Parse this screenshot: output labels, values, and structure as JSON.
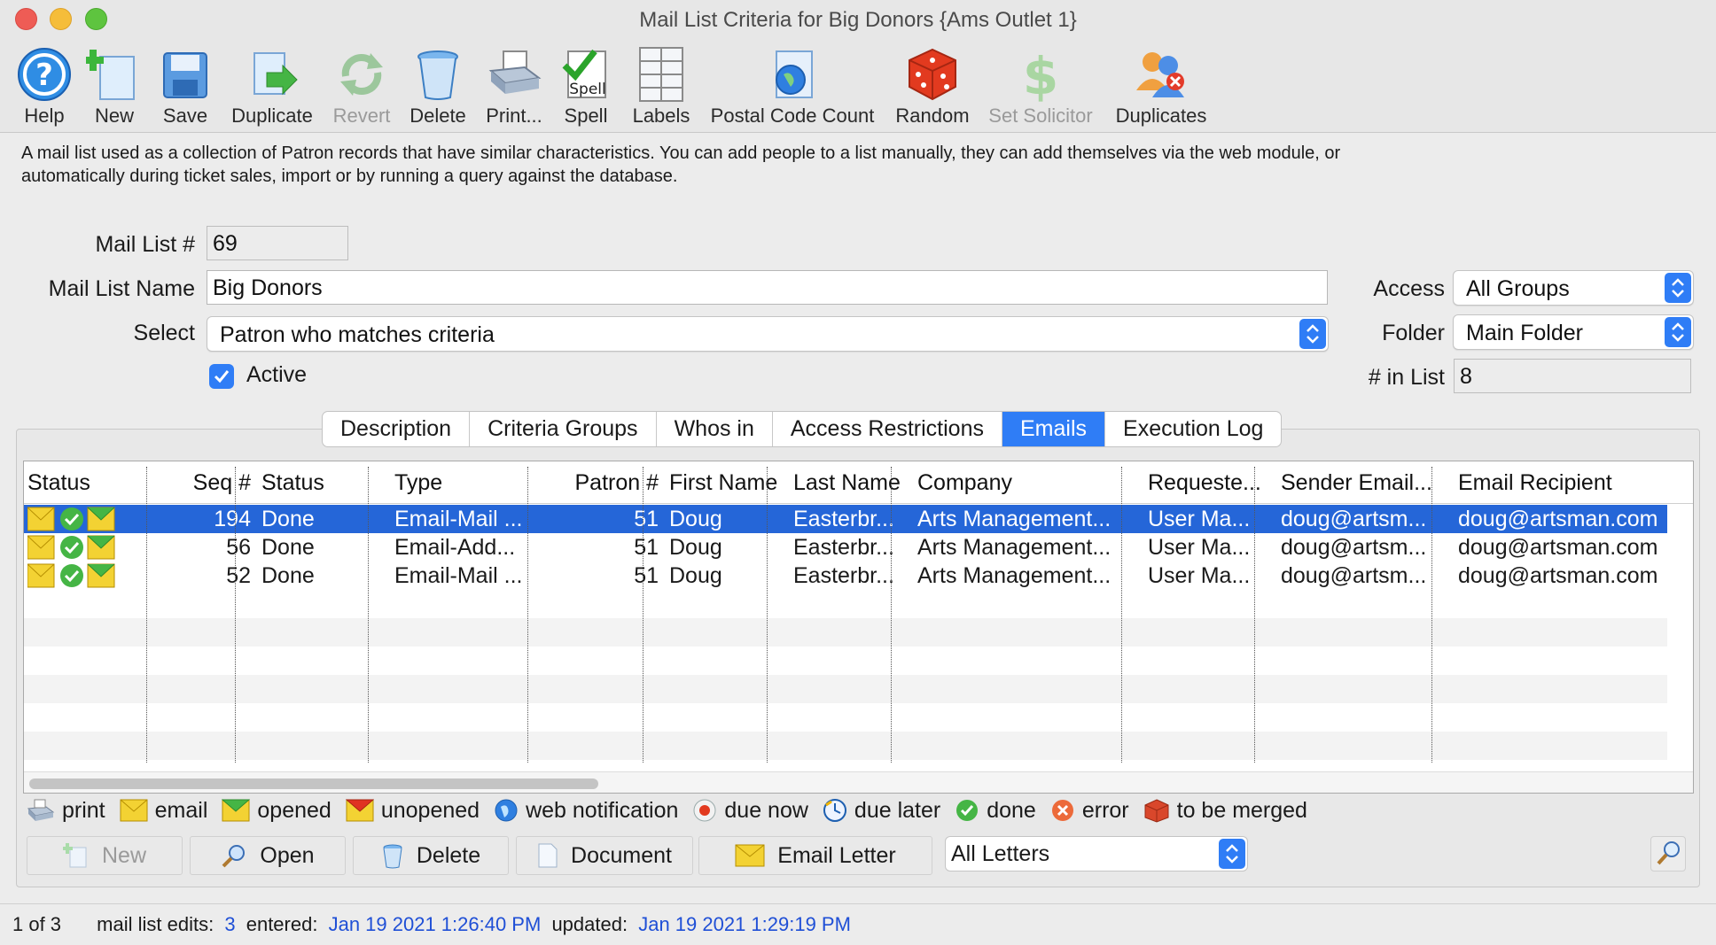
{
  "window": {
    "title": "Mail List Criteria for Big Donors {Ams Outlet 1}"
  },
  "toolbar": {
    "help": "Help",
    "new": "New",
    "save": "Save",
    "duplicate": "Duplicate",
    "revert": "Revert",
    "delete": "Delete",
    "print": "Print...",
    "spell": "Spell",
    "labels": "Labels",
    "postal_code_count": "Postal Code Count",
    "random": "Random",
    "set_solicitor": "Set Solicitor",
    "duplicates": "Duplicates"
  },
  "description_line1": "A mail list used as a collection of Patron records that have similar characteristics.   You can add people to a list manually, they can add themselves via the web module, or",
  "description_line2": "automatically during ticket sales, import or by running a query against the database.",
  "form": {
    "mail_list_no_label": "Mail List #",
    "mail_list_no": "69",
    "mail_list_name_label": "Mail List Name",
    "mail_list_name": "Big Donors",
    "select_label": "Select",
    "select_value": "Patron who matches criteria",
    "active_label": "Active",
    "access_label": "Access",
    "access_value": "All Groups",
    "folder_label": "Folder",
    "folder_value": "Main Folder",
    "in_list_label": "# in List",
    "in_list_value": "8"
  },
  "tabs": [
    "Description",
    "Criteria Groups",
    "Whos in",
    "Access Restrictions",
    "Emails",
    "Execution Log"
  ],
  "table": {
    "columns": [
      "Status",
      "Seq #",
      "Status",
      "Type",
      "Patron #",
      "First Name",
      "Last Name",
      "Company",
      "Requeste...",
      "Sender Email...",
      "Email Recipient"
    ],
    "rows": [
      {
        "seq": "194",
        "status": "Done",
        "type": "Email-Mail ...",
        "patron": "51",
        "first": "Doug",
        "last": "Easterbr...",
        "company": "Arts Management...",
        "requested": "User Ma...",
        "sender": "doug@artsm...",
        "recipient": "doug@artsman.com"
      },
      {
        "seq": "56",
        "status": "Done",
        "type": "Email-Add...",
        "patron": "51",
        "first": "Doug",
        "last": "Easterbr...",
        "company": "Arts Management...",
        "requested": "User Ma...",
        "sender": "doug@artsm...",
        "recipient": "doug@artsman.com"
      },
      {
        "seq": "52",
        "status": "Done",
        "type": "Email-Mail ...",
        "patron": "51",
        "first": "Doug",
        "last": "Easterbr...",
        "company": "Arts Management...",
        "requested": "User Ma...",
        "sender": "doug@artsm...",
        "recipient": "doug@artsman.com"
      }
    ]
  },
  "legend": {
    "print": "print",
    "email": "email",
    "opened": "opened",
    "unopened": "unopened",
    "web_notification": "web notification",
    "due_now": "due now",
    "due_later": "due later",
    "done": "done",
    "error": "error",
    "to_be_merged": "to be merged"
  },
  "buttons": {
    "new": "New",
    "open": "Open",
    "delete": "Delete",
    "document": "Document",
    "email_letter": "Email Letter",
    "letters_select": "All Letters"
  },
  "statusbar": {
    "record": "1 of 3",
    "edits_label": "mail list edits:",
    "edits": "3",
    "entered_label": "entered:",
    "entered": "Jan 19 2021 1:26:40 PM",
    "updated_label": "updated:",
    "updated": "Jan 19 2021 1:29:19 PM"
  },
  "colors": {
    "accent": "#2f7df6",
    "selection": "#2566d8",
    "link": "#1f4fd6"
  }
}
